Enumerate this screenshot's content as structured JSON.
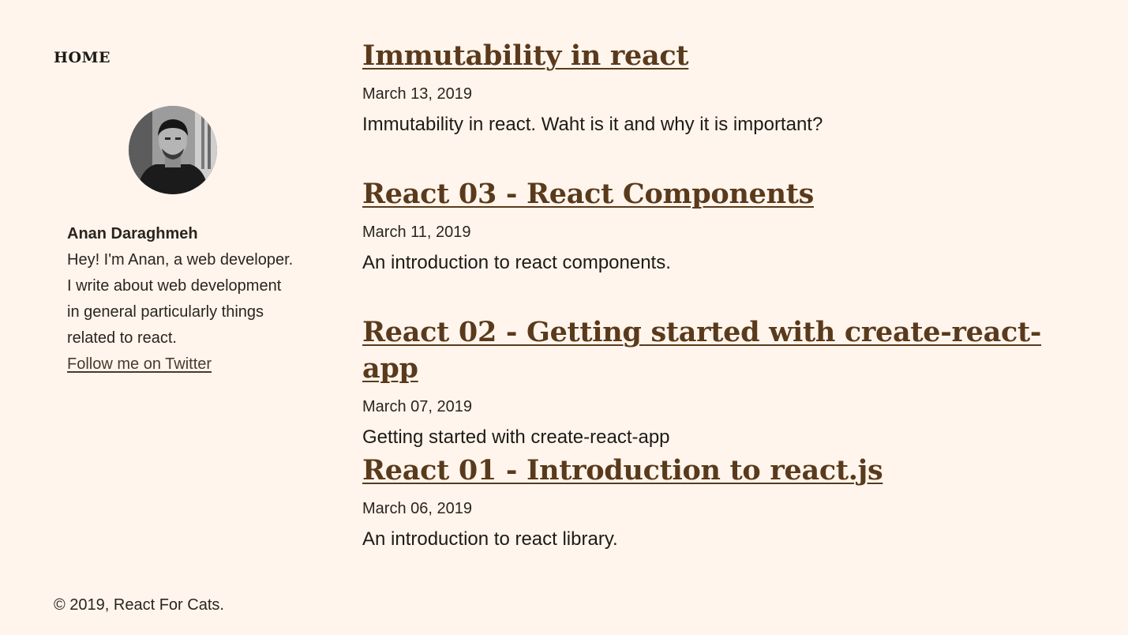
{
  "colors": {
    "background": "#fff5ec",
    "link_title": "#5a3a1c",
    "text": "#1e1a17"
  },
  "nav": {
    "home_label": "HOME"
  },
  "author": {
    "avatar_icon": "author-photo",
    "name": "Anan Daraghmeh",
    "bio": "Hey! I'm Anan, a web developer. I write about web development in general particularly things related to react.",
    "twitter_label": "Follow me on Twitter"
  },
  "posts": [
    {
      "title": "Immutability in react",
      "date": "March 13, 2019",
      "excerpt": "Immutability in react. Waht is it and why it is important?"
    },
    {
      "title": "React 03 - React Components",
      "date": "March 11, 2019",
      "excerpt": "An introduction to react components."
    },
    {
      "title": "React 02 - Getting started with create-react-app",
      "date": "March 07, 2019",
      "excerpt": "Getting started with create-react-app"
    },
    {
      "title": "React 01 - Introduction to react.js",
      "date": "March 06, 2019",
      "excerpt": "An introduction to react library."
    }
  ],
  "footer": {
    "copyright": "© 2019, React For Cats."
  }
}
